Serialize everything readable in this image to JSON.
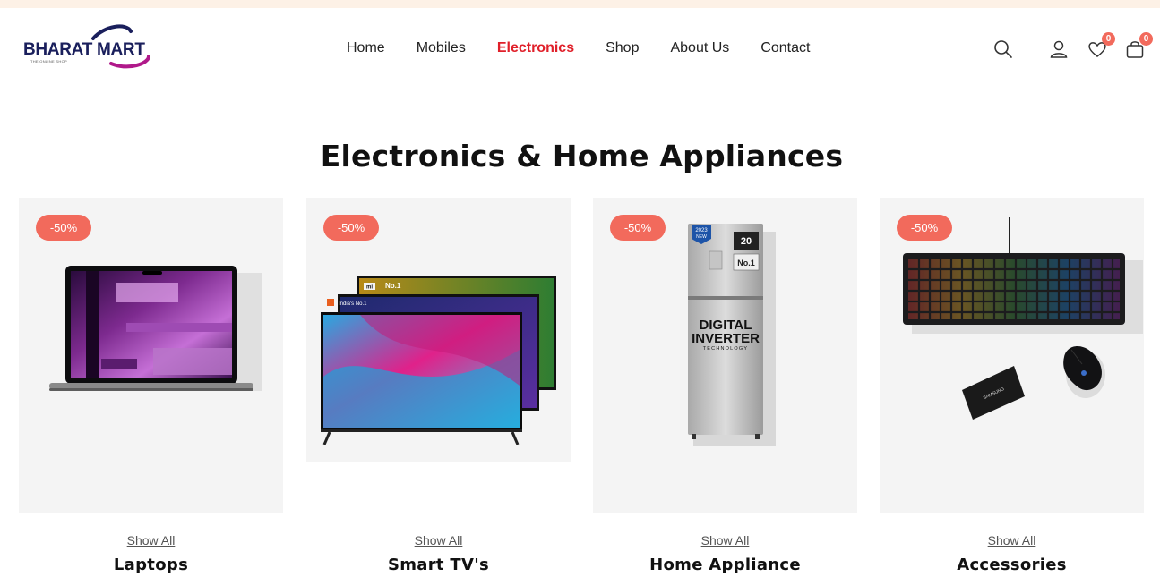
{
  "brand": {
    "name": "BHARAT MART",
    "tagline": "THE ONLINE SHOP"
  },
  "nav": {
    "items": [
      {
        "label": "Home"
      },
      {
        "label": "Mobiles"
      },
      {
        "label": "Electronics"
      },
      {
        "label": "Shop"
      },
      {
        "label": "About Us"
      },
      {
        "label": "Contact"
      }
    ],
    "active": "Electronics"
  },
  "header": {
    "wishlist_count": "0",
    "cart_count": "0"
  },
  "section": {
    "title": "Electronics & Home Appliances"
  },
  "products": [
    {
      "discount": "-50%",
      "show_all": "Show All",
      "name": "Laptops"
    },
    {
      "discount": "-50%",
      "show_all": "Show All",
      "name": "Smart TV's",
      "tv_brand": "mi",
      "tv_text_1": "No.1",
      "tv_text_2": "India's No.1"
    },
    {
      "discount": "-50%",
      "show_all": "Show All",
      "name": "Home Appliance",
      "fridge_year": "2023",
      "fridge_new": "NEW",
      "fridge_temp": "20",
      "fridge_rank": "No.1",
      "fridge_line1": "DIGITAL",
      "fridge_line2": "INVERTER",
      "fridge_line3": "TECHNOLOGY"
    },
    {
      "discount": "-50%",
      "show_all": "Show All",
      "name": "Accessories",
      "ssd_brand": "SAMSUNG"
    }
  ],
  "colors": {
    "accent": "#e0202a",
    "badge": "#f26a5c",
    "brand_navy": "#1a1f5c",
    "brand_arc": "#7a1fa2",
    "card_bg": "#f4f4f4"
  },
  "icons": [
    "search-icon",
    "user-icon",
    "heart-icon",
    "cart-icon"
  ]
}
